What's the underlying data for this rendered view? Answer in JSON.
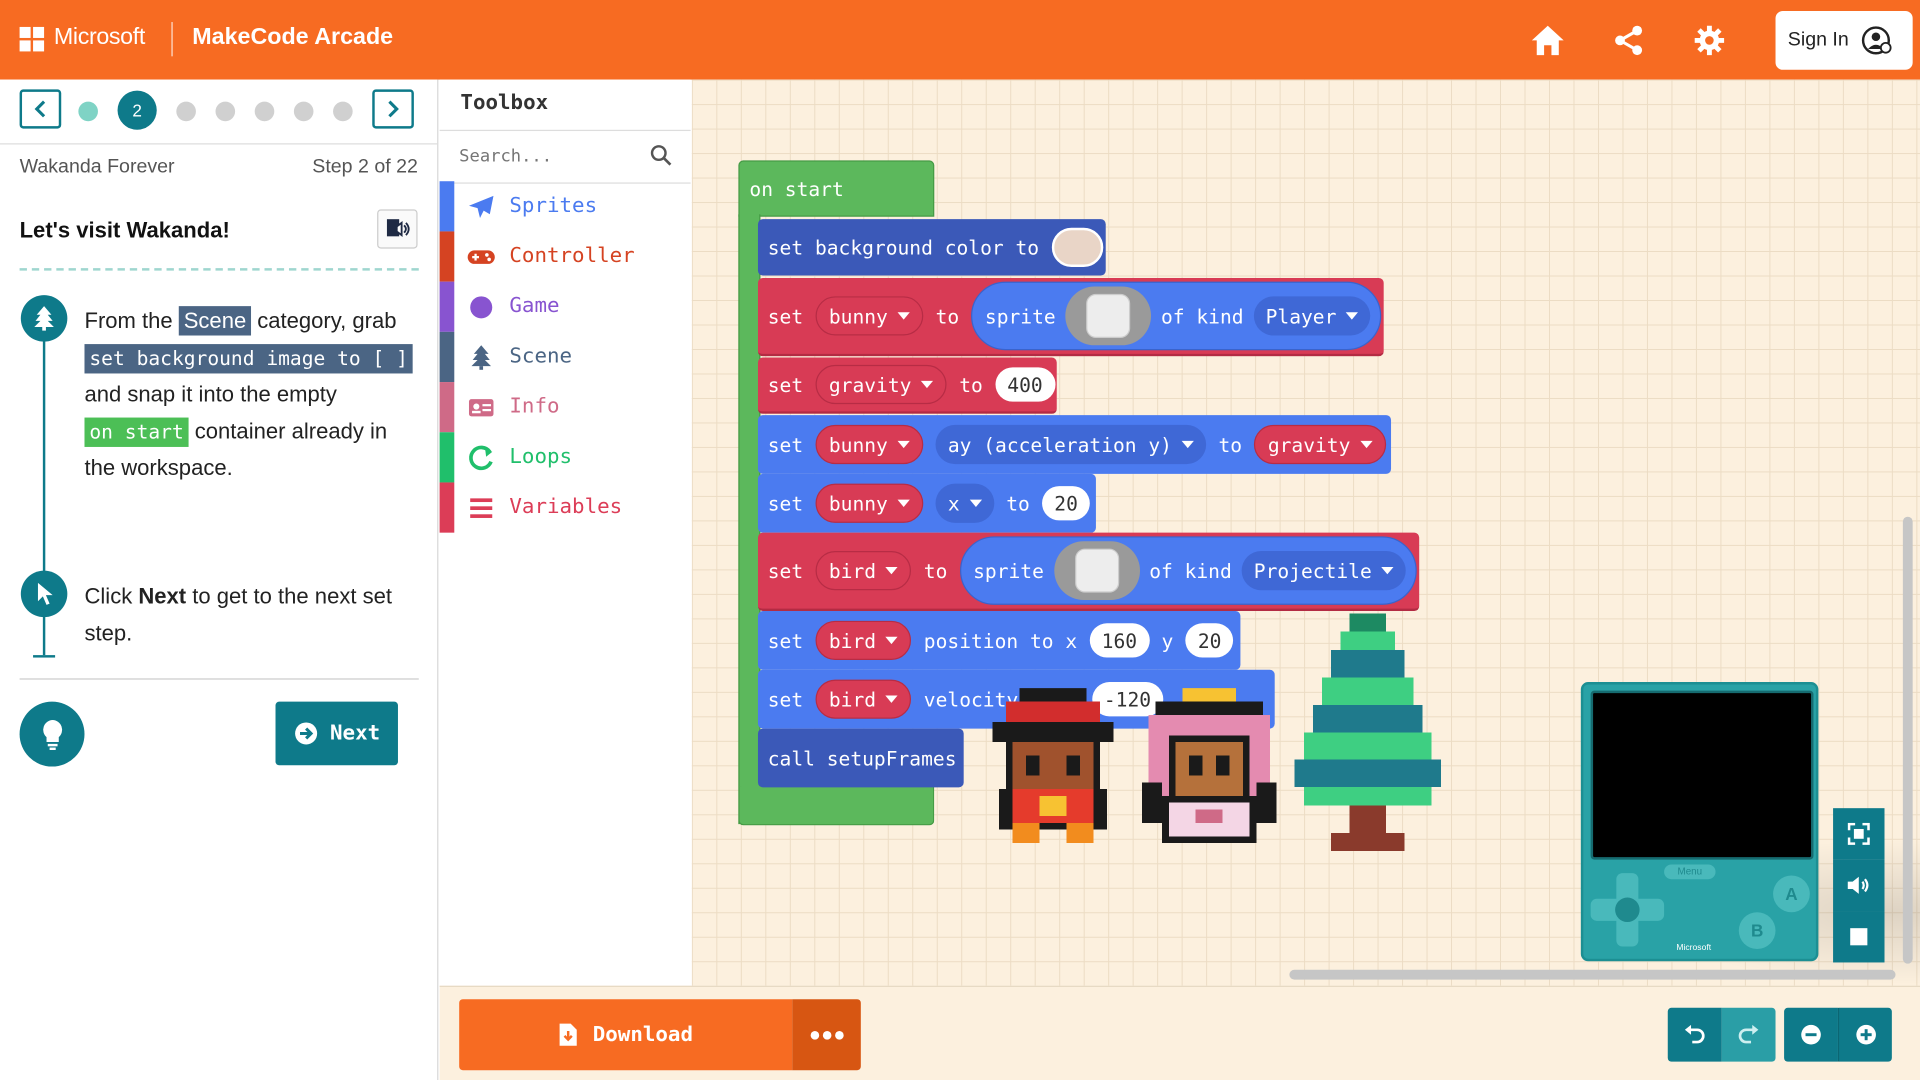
{
  "header": {
    "brand": "Microsoft",
    "app_title": "MakeCode Arcade",
    "icons": [
      "home-icon",
      "share-icon",
      "gear-icon"
    ],
    "signin_label": "Sign In"
  },
  "tutorial": {
    "current_step_label": "2",
    "name": "Wakanda Forever",
    "step_text": "Step 2 of 22",
    "heading": "Let's visit Wakanda!",
    "instr1": {
      "t1": "From the ",
      "chip_scene": "Scene",
      "t2": " category, grab ",
      "chip_block": "set background image to [ ]",
      "t3": " and snap it into the empty ",
      "chip_start": "on start",
      "t4": " container already in the workspace."
    },
    "instr2": {
      "t1": "Click ",
      "bold": "Next",
      "t2": " to get to the next set step."
    },
    "next_label": "Next"
  },
  "toolbox": {
    "title": "Toolbox",
    "search_placeholder": "Search...",
    "categories": [
      {
        "label": "Sprites",
        "color": "#4b7bf0",
        "icon": "paper-plane-icon"
      },
      {
        "label": "Controller",
        "color": "#d54322",
        "icon": "gamepad-icon"
      },
      {
        "label": "Game",
        "color": "#8854d0",
        "icon": "circle-icon"
      },
      {
        "label": "Scene",
        "color": "#4b6584",
        "icon": "tree-icon"
      },
      {
        "label": "Info",
        "color": "#cf6a87",
        "icon": "id-card-icon"
      },
      {
        "label": "Loops",
        "color": "#20bf6b",
        "icon": "loop-icon"
      },
      {
        "label": "Variables",
        "color": "#dc3d57",
        "icon": "list-icon"
      }
    ]
  },
  "blocks": {
    "on_start": "on start",
    "set": "set",
    "to": "to",
    "b1_text": "set background color to",
    "sprite": "sprite",
    "of_kind": "of kind",
    "var_bunny": "bunny",
    "var_gravity": "gravity",
    "var_bird": "bird",
    "kind_player": "Player",
    "kind_projectile": "Projectile",
    "gravity_val": "400",
    "prop_ay": "ay (acceleration y)",
    "prop_x": "x",
    "x_val": "20",
    "position_to_x": "position to x",
    "pos_x": "160",
    "y": "y",
    "pos_y": "20",
    "velocity": "velocity",
    "vel_x": "-120",
    "call": "call setupFrames"
  },
  "simulator": {
    "menu_label": "Menu",
    "btn_a": "A",
    "btn_b": "B",
    "brand": "Microsoft"
  },
  "bottom": {
    "download_label": "Download"
  }
}
